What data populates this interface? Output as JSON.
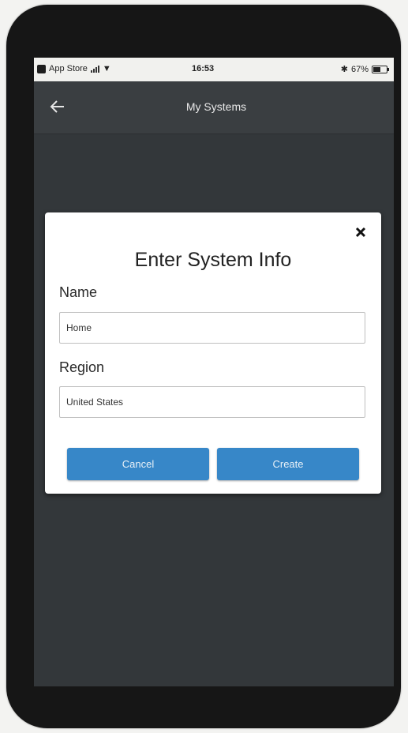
{
  "status_bar": {
    "carrier": "App Store",
    "time": "16:53",
    "battery": "67%"
  },
  "app_bar": {
    "title": "My Systems",
    "back_icon": "arrow-left-icon"
  },
  "dialog": {
    "title": "Enter System Info",
    "close_icon": "close-icon",
    "name_label": "Name",
    "name_value": "Home",
    "region_label": "Region",
    "region_value": "United States",
    "cancel_label": "Cancel",
    "create_label": "Create"
  },
  "colors": {
    "accent": "#3787c8",
    "background": "#33373a",
    "dialog": "#ffffff"
  }
}
